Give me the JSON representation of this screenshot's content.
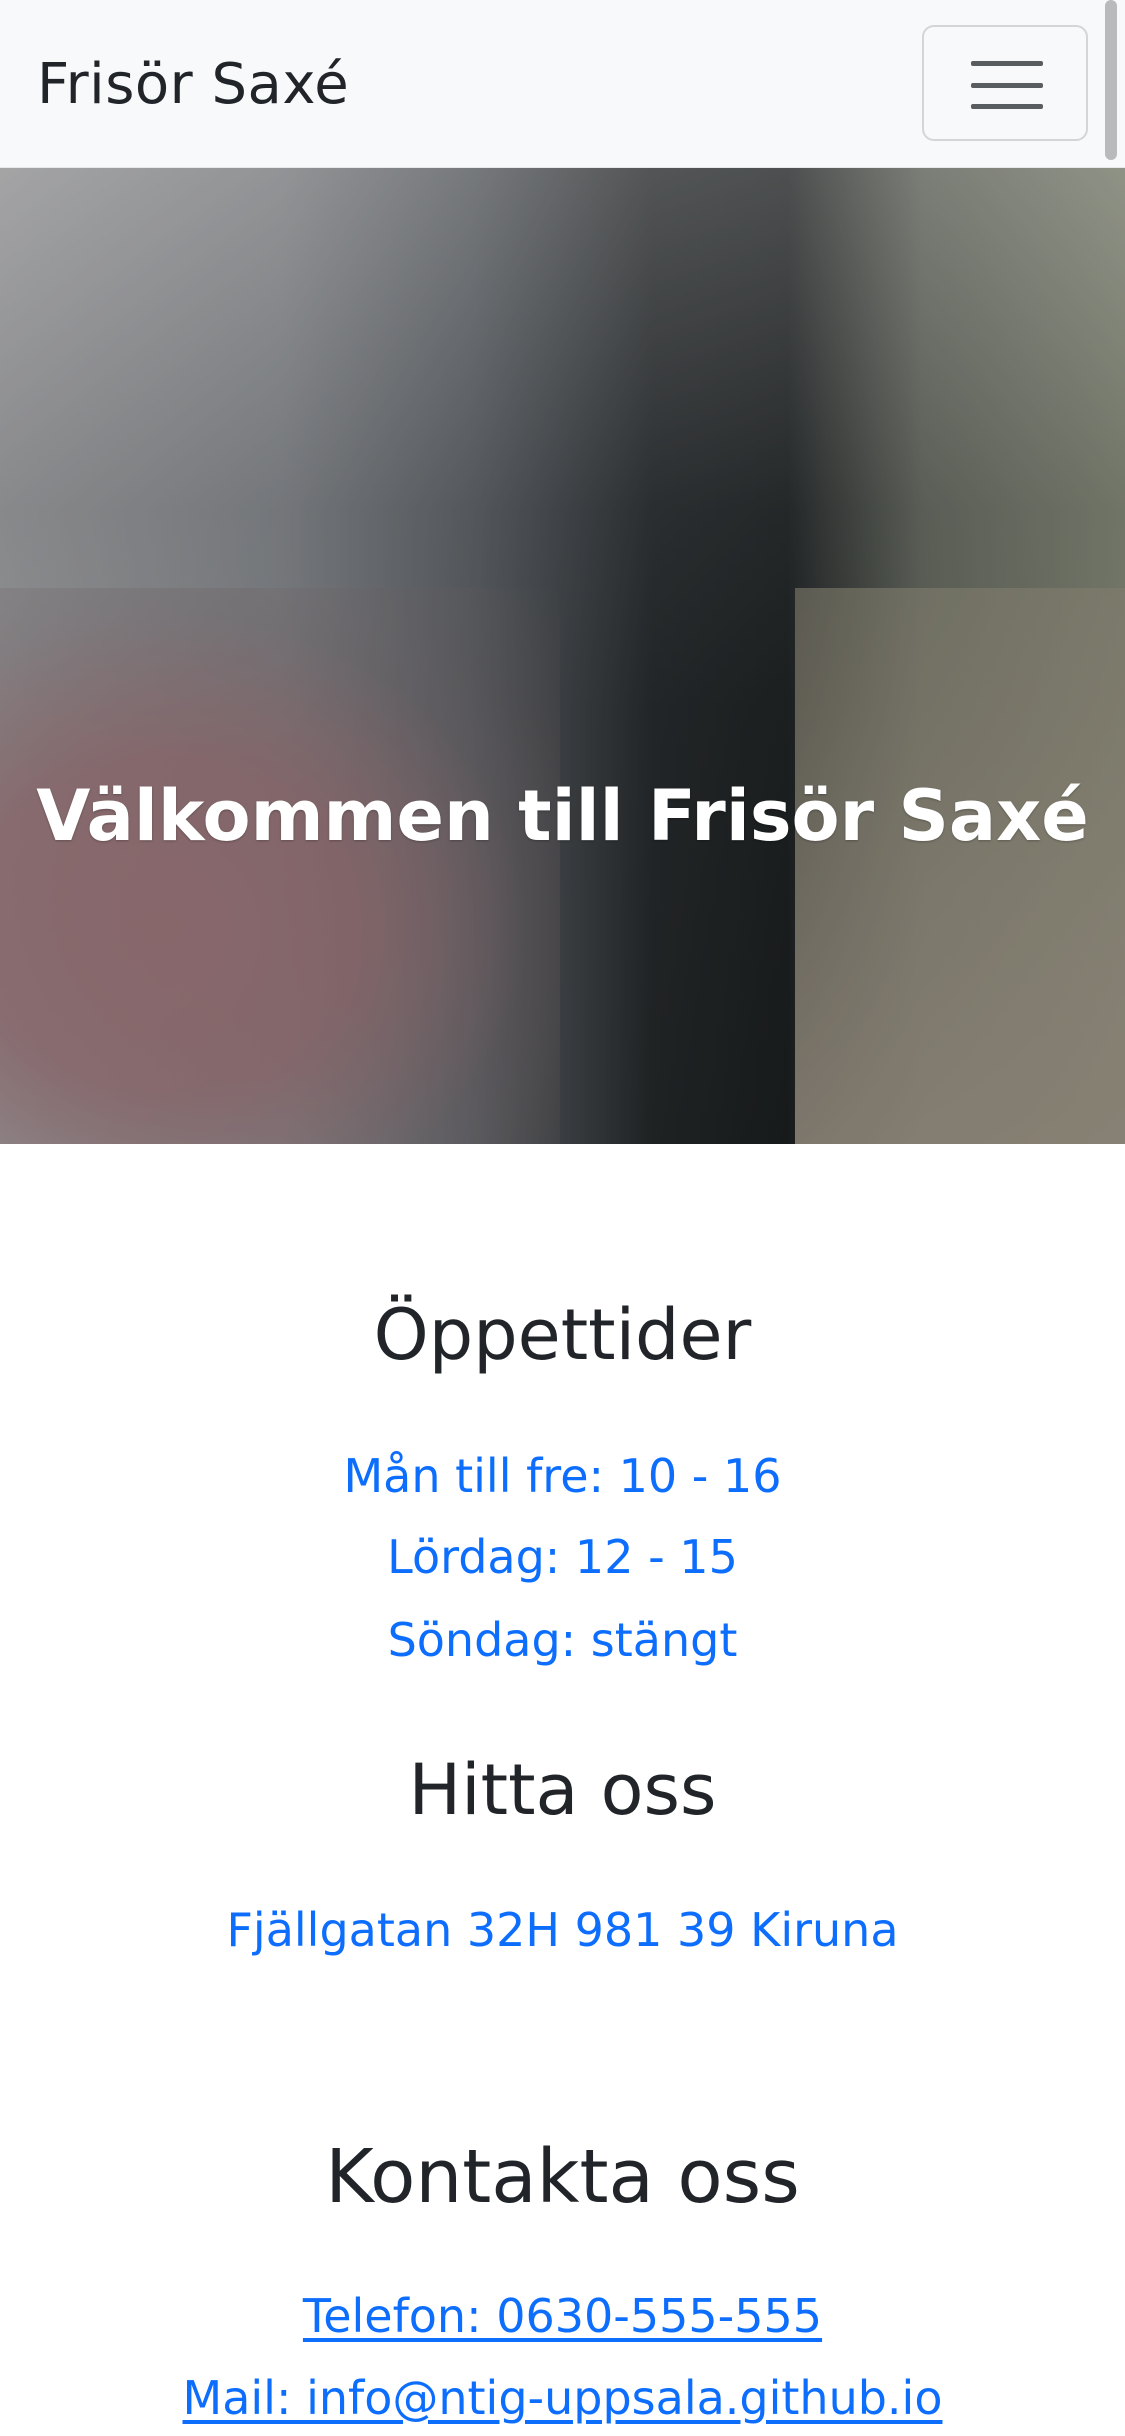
{
  "navbar": {
    "brand": "Frisör Saxé",
    "toggle_icon": "hamburger-menu-icon"
  },
  "hero": {
    "title": "Välkommen till Frisör Saxé"
  },
  "hours": {
    "heading": "Öppettider",
    "items": [
      "Mån till fre: 10 - 16",
      "Lördag: 12 - 15",
      "Söndag: stängt"
    ]
  },
  "location": {
    "heading": "Hitta oss",
    "address": "Fjällgatan 32H 981 39 Kiruna"
  },
  "contact": {
    "heading": "Kontakta oss",
    "phone": "Telefon: 0630-555-555",
    "mail": "Mail: info@ntig-uppsala.github.io"
  },
  "colors": {
    "link": "#0d6efd",
    "text": "#212529",
    "navbar_bg": "#f8f9fa"
  }
}
